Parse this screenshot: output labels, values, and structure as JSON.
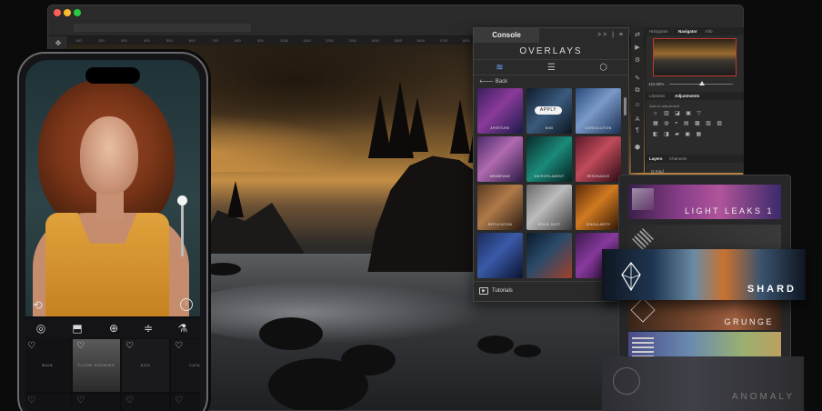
{
  "colors": {
    "window_bg": "#242424",
    "panel_bg": "#2a2a2b",
    "accent_apply": "#f2f2f2",
    "traffic_close": "#ff5f57",
    "traffic_min": "#febc2e",
    "traffic_max": "#28c840",
    "nav_frame": "#c0392b"
  },
  "ruler": {
    "ticks": [
      "100",
      "200",
      "300",
      "400",
      "500",
      "600",
      "700",
      "800",
      "900",
      "1000",
      "1100",
      "1200",
      "1300",
      "1400",
      "1500",
      "1600",
      "1700",
      "1800",
      "1900",
      "2000",
      "2100",
      "2200",
      "2300",
      "2400",
      "2500"
    ]
  },
  "left_tools": [
    "move-icon",
    "marquee-icon"
  ],
  "console": {
    "tab_label": "Console",
    "header_controls": ">> | ≡",
    "title": "OVERLAYS",
    "icons": [
      "layers-icon",
      "sliders-icon",
      "gear-icon"
    ],
    "back_label": "Back",
    "apply_label": "APPLY",
    "overlays": [
      {
        "label": "APERTURE",
        "bg": "linear-gradient(135deg,#3b1f5e,#8a3a9a 45%,#1a1a4a)"
      },
      {
        "label": "NIMI",
        "bg": "linear-gradient(135deg,#0f1d2e,#3b5a7c 50%,#0b1420)"
      },
      {
        "label": "CONVOLUTION",
        "bg": "linear-gradient(135deg,#2a4a7a,#7a9ac8 45%,#1b2e52)"
      },
      {
        "label": "MEMBRANE",
        "bg": "linear-gradient(135deg,#4a2a6a,#b06ab0 45%,#2a1a44)"
      },
      {
        "label": "MICROFILAMENT",
        "bg": "linear-gradient(135deg,#0a2a2a,#1a8a7a 50%,#06201e)"
      },
      {
        "label": "RESONANCE",
        "bg": "linear-gradient(135deg,#5a1a2a,#c04a5a 45%,#2a0a14)"
      },
      {
        "label": "REPLICATION",
        "bg": "linear-gradient(135deg,#5a3a20,#b07a4a 45%,#2a1a10)"
      },
      {
        "label": "SPACE DUST",
        "bg": "linear-gradient(135deg,#6a6a6a,#bcbcbc 45%,#3a3a3a)"
      },
      {
        "label": "SINGULARITY",
        "bg": "linear-gradient(135deg,#5a2a0a,#d07a20 45%,#2a1204)"
      },
      {
        "label": "",
        "bg": "linear-gradient(135deg,#1a2a5a,#3a5aa8 45%,#0a1230)"
      },
      {
        "label": "",
        "bg": "linear-gradient(135deg,#0a1a2a,#2a4a6a 45%,#a0402a)"
      },
      {
        "label": "",
        "bg": "linear-gradient(135deg,#3a1a4a,#8a3aa0 45%,#1a0a2a)"
      }
    ],
    "footer_label": "Tutorials"
  },
  "right_panel": {
    "nav_tabs": [
      "Histogram",
      "Navigator",
      "Info"
    ],
    "zoom": "110.58%",
    "adj_tabs": [
      "Libraries",
      "Adjustments"
    ],
    "add_adjustment": "Add an adjustment",
    "adj_rows": [
      "☼ ▥ ◪ ▣ ▽",
      "▦ ◍ ◓ ▤ ▩ ▨ ▧",
      "◧ ◨ ▰ ▣ ▦"
    ],
    "layers_tabs": [
      "Layers",
      "Channels"
    ],
    "layer_search": "Q Kind"
  },
  "layer_cards": [
    {
      "name": "LIGHT LEAKS 1",
      "bg": "linear-gradient(90deg,#3a1f4a 0%,#8a3e8a 35%,#b0549a 60%,#3a2a6a 100%)"
    },
    {
      "name": "",
      "bg": "linear-gradient(90deg,#2a2a2a,#3a3a3a)"
    },
    {
      "name": "GRUNGE",
      "bg": "linear-gradient(90deg,#3a2418 0%,#7a4a30 45%,#a26040 70%,#3a2418 100%)"
    },
    {
      "name": "",
      "bg": "linear-gradient(90deg,#4a4a88 0%,#6a8ab0 40%,#9ab070 75%,#bca060 100%)"
    }
  ],
  "shard_card": {
    "name": "SHARD"
  },
  "anomaly_card": {
    "name": "ANOMALY"
  },
  "phone": {
    "tools": [
      "overlay-circles-icon",
      "crop-icon",
      "add-icon",
      "sliders-icon",
      "flask-icon"
    ],
    "presets": [
      {
        "label": "MAIN",
        "bg": "#121214"
      },
      {
        "label": "FLOOR SHOWING",
        "bg": "linear-gradient(180deg,#5a5a5a,#2a2a2a)"
      },
      {
        "label": "EGO",
        "bg": "#1a1a1c"
      },
      {
        "label": "CATA",
        "bg": "#141416"
      }
    ]
  }
}
